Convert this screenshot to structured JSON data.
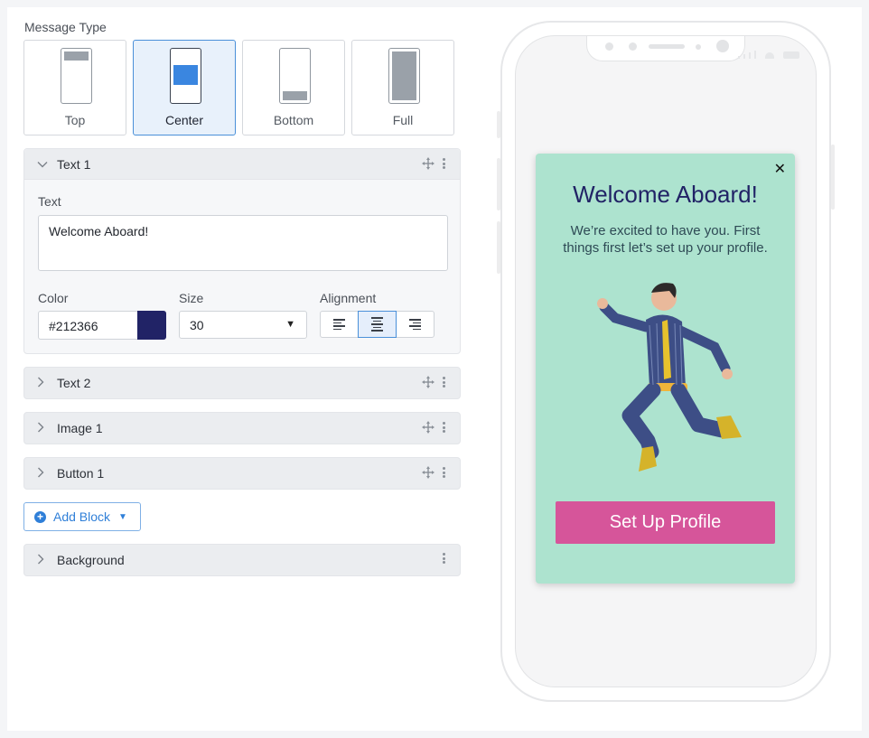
{
  "message_type": {
    "label": "Message Type",
    "options": [
      {
        "label": "Top",
        "selected": false
      },
      {
        "label": "Center",
        "selected": true
      },
      {
        "label": "Bottom",
        "selected": false
      },
      {
        "label": "Full",
        "selected": false
      }
    ]
  },
  "blocks": {
    "text1": {
      "title": "Text 1",
      "text_label": "Text",
      "text_value": "Welcome Aboard!",
      "color_label": "Color",
      "color_value": "#212366",
      "size_label": "Size",
      "size_value": "30",
      "alignment_label": "Alignment",
      "alignment_selected": "center"
    },
    "text2": {
      "title": "Text 2"
    },
    "image1": {
      "title": "Image 1"
    },
    "button1": {
      "title": "Button 1"
    },
    "background": {
      "title": "Background"
    }
  },
  "add_block": {
    "label": "Add Block"
  },
  "preview": {
    "title": "Welcome Aboard!",
    "subtitle": "We’re excited to have you. First things first let’s set up your profile.",
    "button_label": "Set Up Profile",
    "close_glyph": "✕",
    "bg_color": "#ade3cf",
    "button_color": "#d6559a",
    "title_color": "#212366"
  },
  "icons": {
    "collapse": "chevron-down-icon",
    "expand": "chevron-right-icon",
    "move": "move-icon",
    "more": "more-vertical-icon",
    "add": "plus-circle-icon",
    "close": "close-icon"
  }
}
